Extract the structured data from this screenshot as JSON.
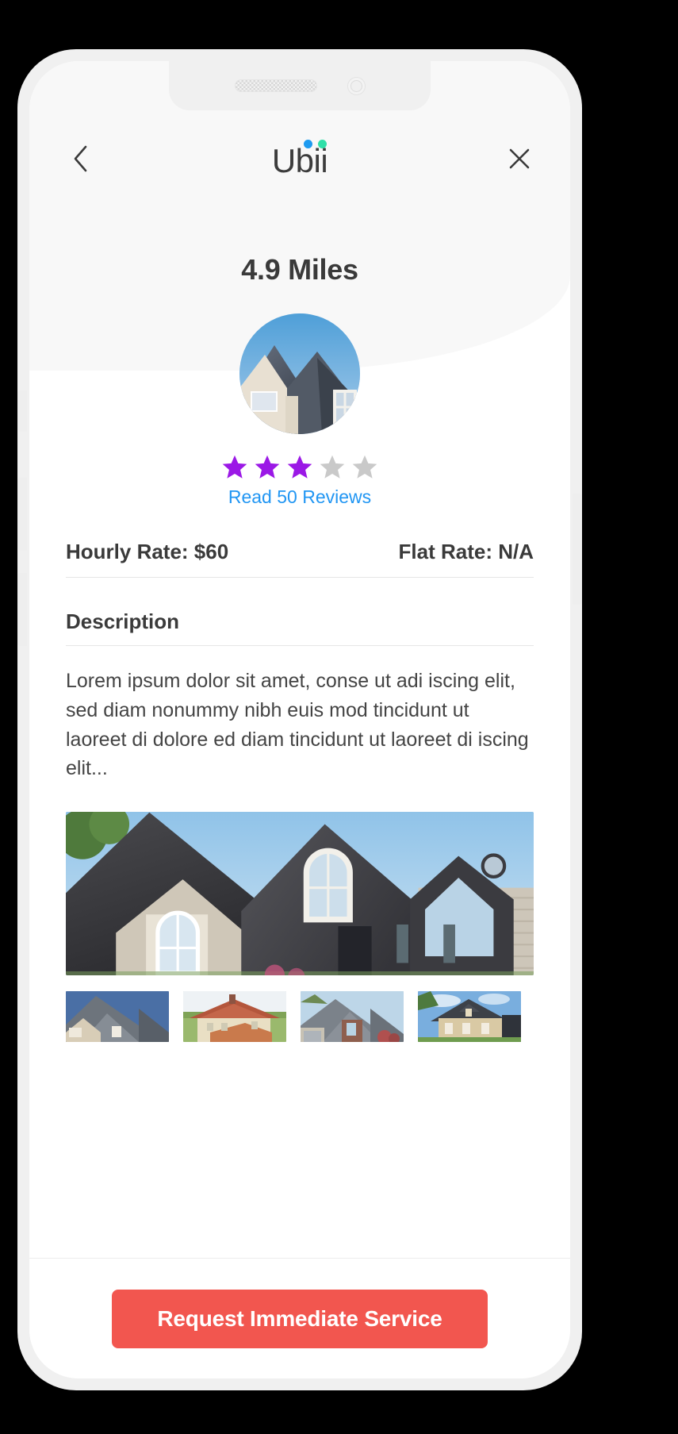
{
  "app": {
    "logo_text": "Ubii",
    "logo_dot_blue": "#1e9bf0",
    "logo_dot_green": "#2fe0a8"
  },
  "header": {
    "back_icon": "chevron-left-icon",
    "close_icon": "close-x-icon"
  },
  "provider": {
    "distance": "4.9 Miles",
    "avatar_alt": "roof-photo-avatar",
    "rating_filled": 3,
    "rating_total": 5,
    "star_filled_color": "#9b18e6",
    "star_empty_color": "#c9c9c9",
    "reviews_link": "Read 50 Reviews",
    "reviews_link_color": "#2196f3"
  },
  "rates": {
    "hourly": "Hourly Rate: $60",
    "flat": "Flat Rate: N/A"
  },
  "description": {
    "title": "Description",
    "body": "Lorem ipsum dolor sit amet, conse ut adi iscing elit, sed diam nonummy nibh euis mod tincidunt ut laoreet di dolore ed diam tincidunt ut laoreet di iscing elit..."
  },
  "gallery": {
    "main_alt": "main-roof-photo",
    "thumbnails": [
      {
        "alt": "thumbnail-gray-shingle-roof"
      },
      {
        "alt": "thumbnail-red-tile-roof"
      },
      {
        "alt": "thumbnail-brick-house-roof"
      },
      {
        "alt": "thumbnail-tan-two-story-house"
      }
    ]
  },
  "footer": {
    "cta_label": "Request Immediate Service",
    "cta_color": "#f2564f"
  }
}
